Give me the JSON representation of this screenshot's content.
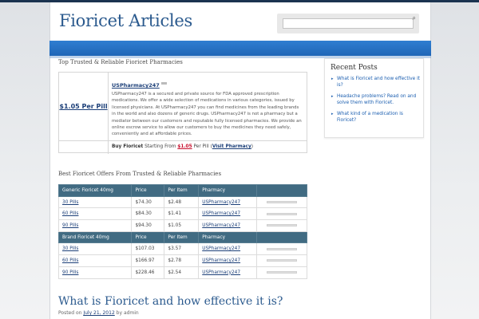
{
  "site": {
    "title": "Fioricet Articles"
  },
  "search": {
    "placeholder": "",
    "icon": "search-icon"
  },
  "pharmacies": {
    "section_title": "Top Trusted & Reliable Fioricet Pharmacies",
    "listing": {
      "price_label": "$1.05 Per Pill",
      "name": "USPharmacy247",
      "description": "USPharmacy247 is a secured and private source for FDA approved prescription medications. We offer a wide selection of medications in various categories, issued by licensed physicians. At USPharmacy247 you can find medicines from the leading brands in the world and also dozens of generic drugs. USPharmacy247 is not a pharmacy but a mediator between our customers and reputable fully licensed pharmacies. We provide an online escrow service to allow our customers to buy the medicines they need safely, conveniently and at affordable prices.",
      "buy_prefix": "Buy Fioricet",
      "buy_from": " Starting From ",
      "buy_price": "$1.05",
      "buy_per_pill": " Per Pill (",
      "visit_label": "Visit Pharmacy",
      "buy_suffix": ")"
    }
  },
  "offers": {
    "title": "Best Fioricet Offers From Trusted & Reliable Pharmacies",
    "groups": [
      {
        "headers": [
          "Generic Fioricet 40mg",
          "Price",
          "Per Item",
          "Pharmacy"
        ],
        "rows": [
          {
            "pills": "30 Pills",
            "price": "$74.30",
            "per_item": "$2.48",
            "pharmacy": "USPharmacy247"
          },
          {
            "pills": "60 Pills",
            "price": "$84.30",
            "per_item": "$1.41",
            "pharmacy": "USPharmacy247"
          },
          {
            "pills": "90 Pills",
            "price": "$94.30",
            "per_item": "$1.05",
            "pharmacy": "USPharmacy247"
          }
        ]
      },
      {
        "headers": [
          "Brand Fioricet 40mg",
          "Price",
          "Per Item",
          "Pharmacy"
        ],
        "rows": [
          {
            "pills": "30 Pills",
            "price": "$107.03",
            "per_item": "$3.57",
            "pharmacy": "USPharmacy247"
          },
          {
            "pills": "60 Pills",
            "price": "$166.97",
            "per_item": "$2.78",
            "pharmacy": "USPharmacy247"
          },
          {
            "pills": "90 Pills",
            "price": "$228.46",
            "per_item": "$2.54",
            "pharmacy": "USPharmacy247"
          }
        ]
      }
    ]
  },
  "post": {
    "title": "What is Fioricet and how effective it is?",
    "meta_prefix": "Posted on ",
    "date": "July 21, 2012",
    "meta_by": " by admin"
  },
  "sidebar": {
    "title": "Recent Posts",
    "items": [
      "What is Fioricet and how effective it is?",
      "Headache problems? Read on and solve them with Fioricet.",
      "What kind of a medication is Fioricet?"
    ]
  },
  "colors": {
    "nav": "#1f66b7",
    "title": "#2b5a8e",
    "table_header": "#416b82",
    "price_red": "#c8102e"
  }
}
